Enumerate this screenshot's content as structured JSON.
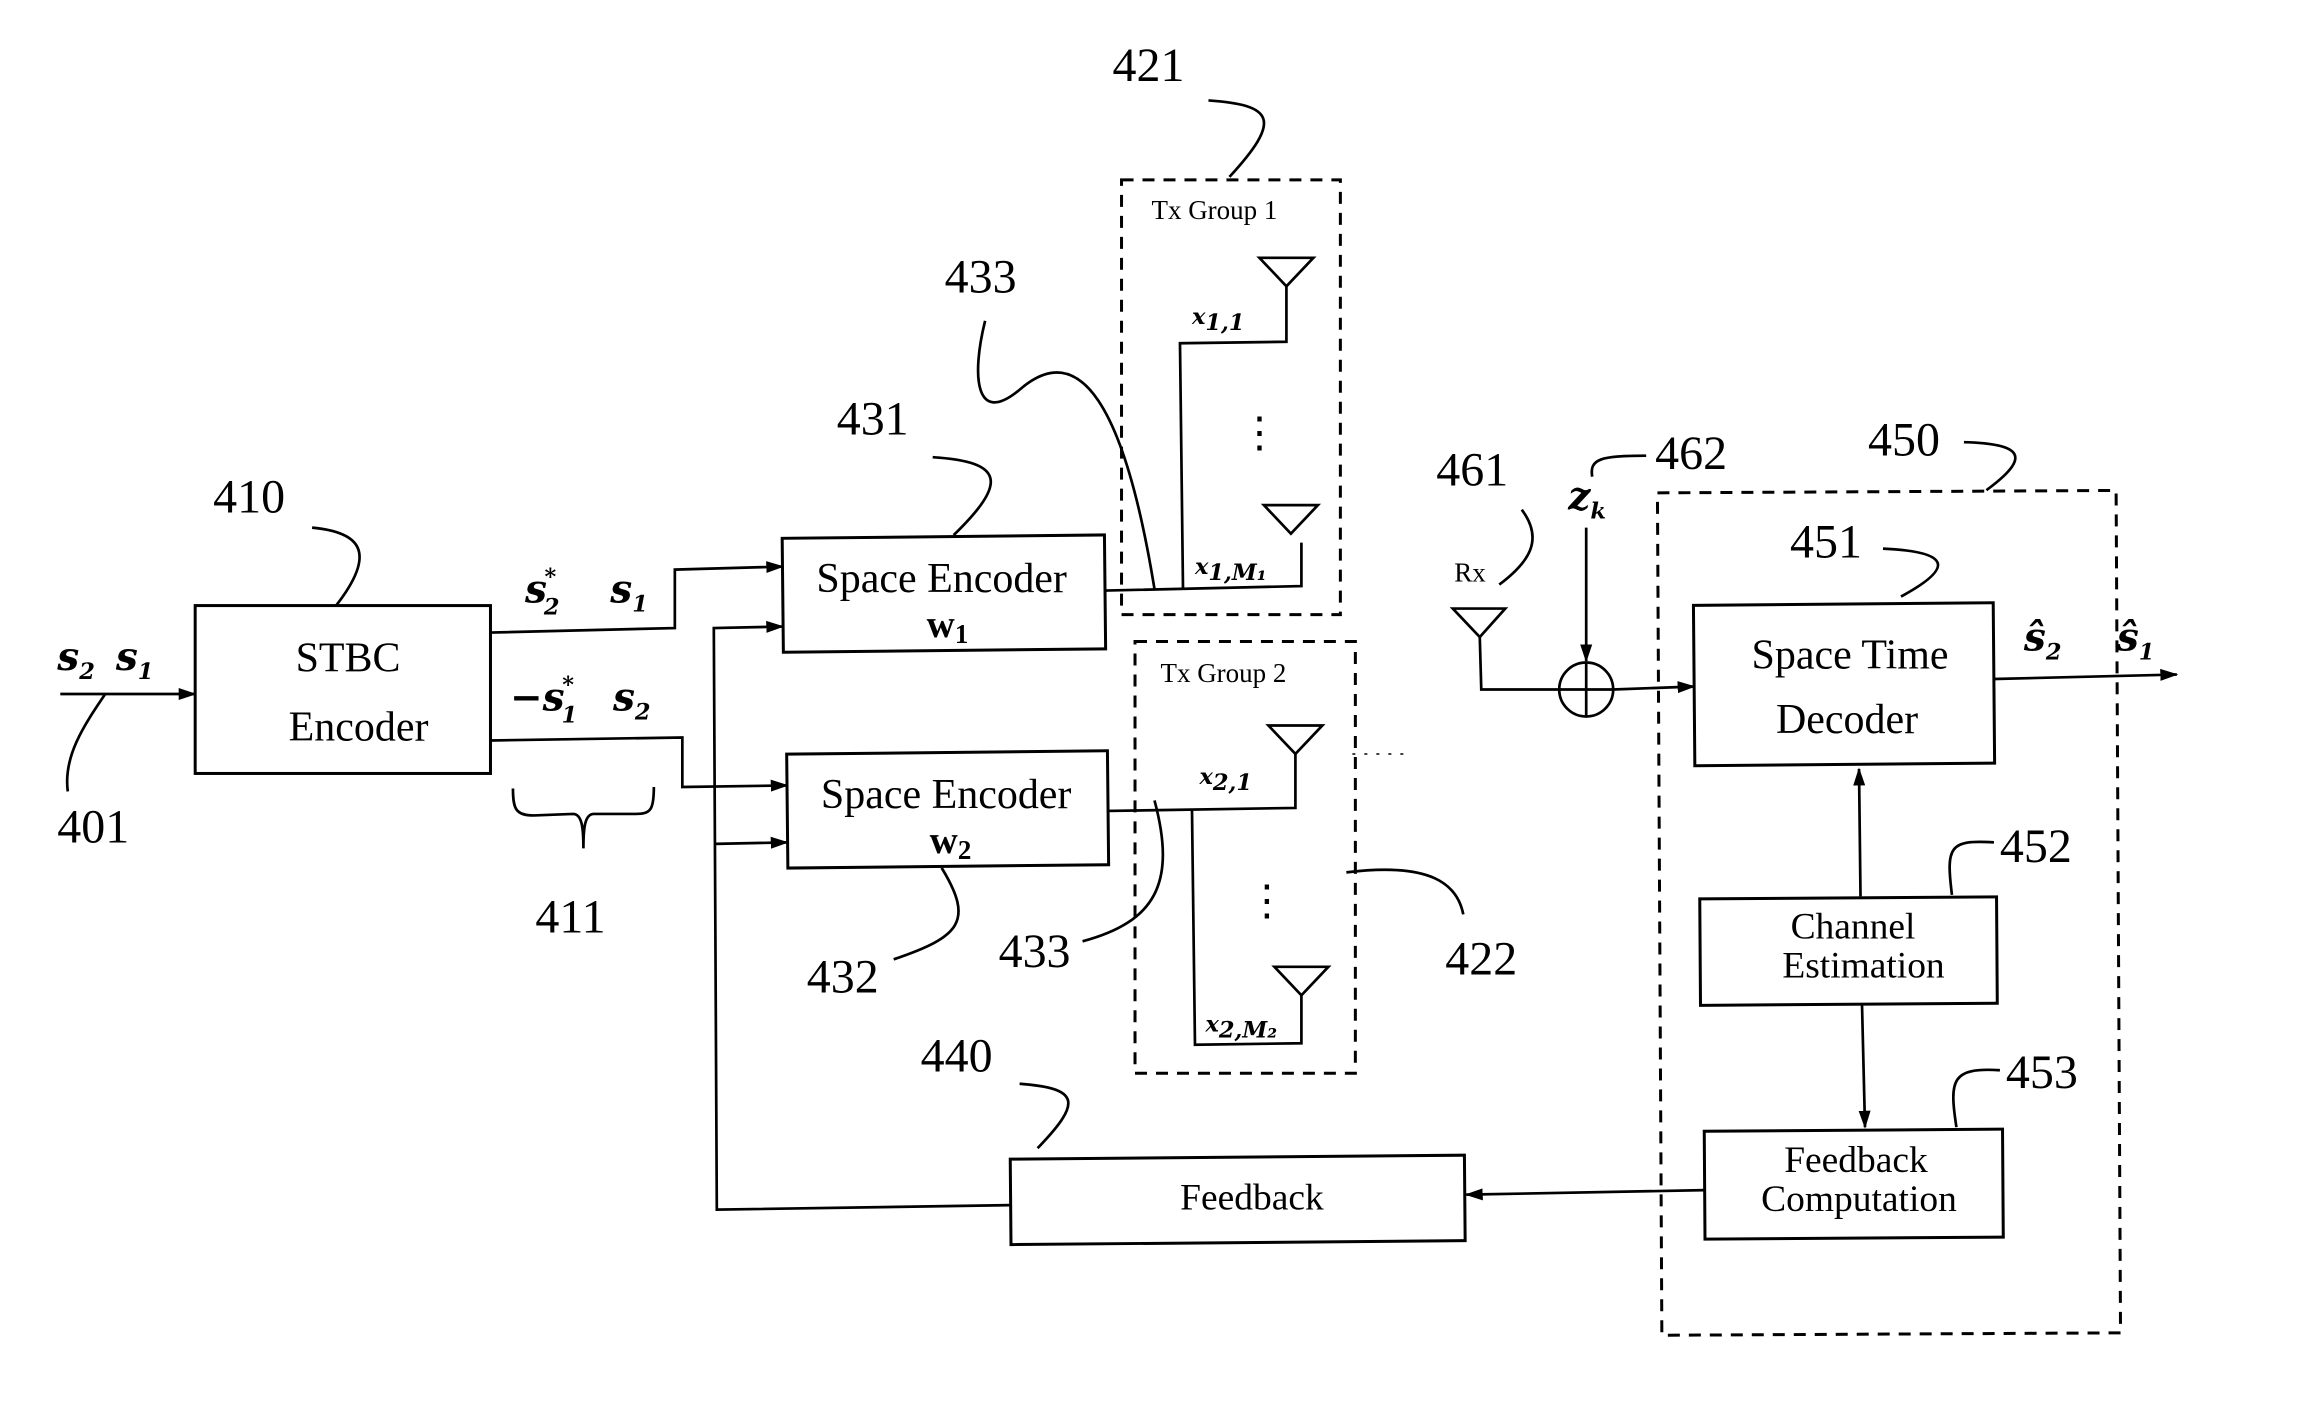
{
  "figure": {
    "type": "block diagram",
    "subject": "STBC transmit diversity system with grouped transmit antennas and feedback"
  },
  "input": {
    "signal_label": [
      "s",
      "2",
      "s",
      "1"
    ],
    "ref": "401"
  },
  "stbc_encoder": {
    "line1": "STBC",
    "line2": "Encoder",
    "ref": "410"
  },
  "stbc_outputs": {
    "top": {
      "sym1": "s",
      "sub1": "2",
      "sup1": "*",
      "sym2": "s",
      "sub2": "1"
    },
    "bottom": {
      "neg": "−",
      "sym1": "s",
      "sub1": "1",
      "sup1": "*",
      "sym2": "s",
      "sub2": "2"
    },
    "brace_ref": "411"
  },
  "space_encoders": [
    {
      "label": "Space Encoder",
      "weight": "w",
      "weight_sub": "1",
      "ref": "431"
    },
    {
      "label": "Space Encoder",
      "weight": "w",
      "weight_sub": "2",
      "ref": "432"
    }
  ],
  "link_ref": "433",
  "tx_groups": [
    {
      "title": "Tx Group 1",
      "ref": "421",
      "antennas": [
        {
          "sym": "x",
          "sub": "1,1"
        },
        {
          "sym": "x",
          "sub": "1,M₁"
        }
      ],
      "ellipsis": "⋮"
    },
    {
      "title": "Tx Group 2",
      "ref": "422",
      "antennas": [
        {
          "sym": "x",
          "sub": "2,1"
        },
        {
          "sym": "x",
          "sub": "2,M₂"
        }
      ],
      "ellipsis": "⋮"
    }
  ],
  "feedback": {
    "label": "Feedback",
    "ref": "440"
  },
  "receiver": {
    "antenna_label": "Rx",
    "antenna_ref": "461",
    "noise": {
      "sym": "z",
      "sub": "k",
      "ref": "462"
    },
    "group_ref": "450",
    "decoder": {
      "line1": "Space Time",
      "line2": "Decoder",
      "ref": "451"
    },
    "outputs": [
      {
        "sym": "ŝ",
        "sub": "2"
      },
      {
        "sym": "ŝ",
        "sub": "1"
      }
    ],
    "channel_estimation": {
      "line1": "Channel",
      "line2": "Estimation",
      "ref": "452"
    },
    "feedback_computation": {
      "line1": "Feedback",
      "line2": "Computation",
      "ref": "453"
    }
  }
}
